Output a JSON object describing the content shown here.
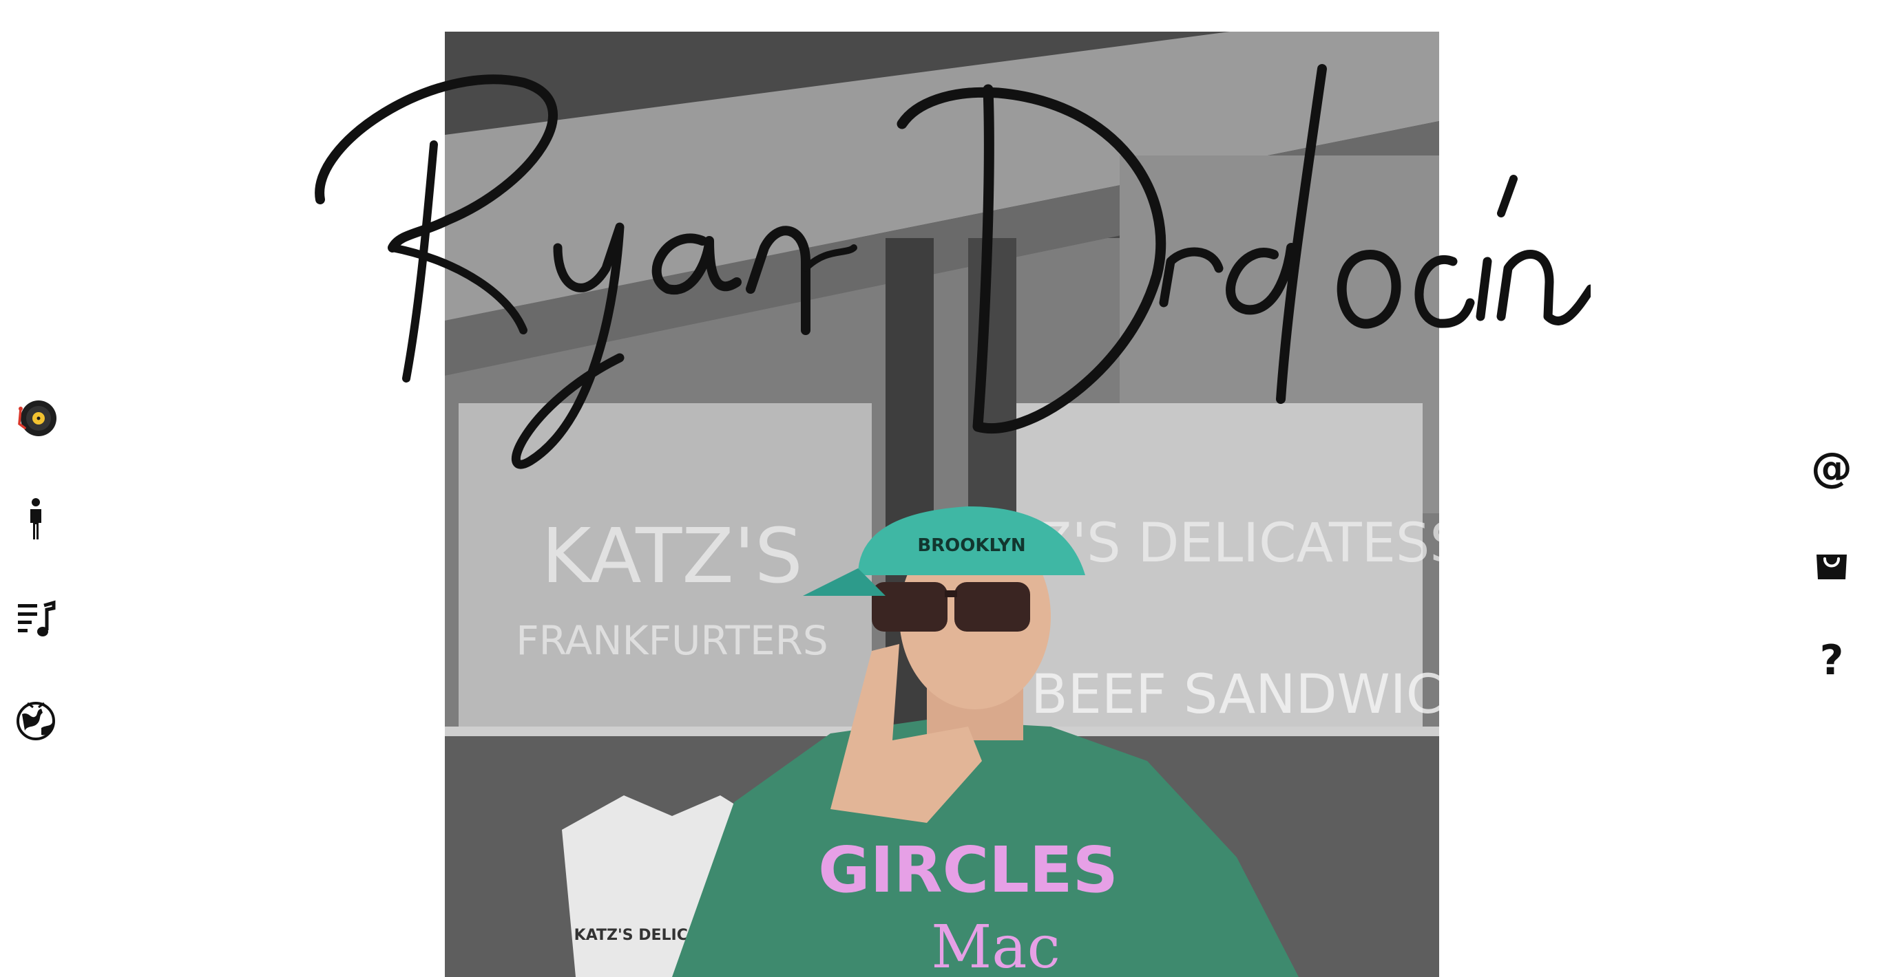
{
  "site": {
    "artist_name": "Ryan Drdocin"
  },
  "left_nav": [
    {
      "icon": "turntable-vinyl-icon",
      "label": "Music"
    },
    {
      "icon": "person-icon",
      "label": "About"
    },
    {
      "icon": "playlist-icon",
      "label": "Playlists"
    },
    {
      "icon": "globe-icon",
      "label": "World"
    }
  ],
  "right_nav": [
    {
      "icon": "at-sign-icon",
      "glyph": "@"
    },
    {
      "icon": "shopping-bag-icon",
      "glyph": ""
    },
    {
      "icon": "question-mark-icon",
      "glyph": "?"
    }
  ],
  "photo": {
    "shop_sign_left": "KATZ'S",
    "shop_sign_left_sub": "FRANKFURTERS",
    "shop_sign_right": "KATZ'S DELICATESSEN",
    "shop_sign_right_sub": "BEEF SANDWICH",
    "cap_text": "BROOKLYN",
    "shirt_text": "GIRCLES",
    "shirt_text_sub": "Mac",
    "tshirt_text": "KATZ'S DELICATESSEN"
  },
  "colors": {
    "ink": "#111111",
    "shirt_green": "#3e8a6e",
    "cap_teal": "#3fb7a4",
    "shirt_pink": "#e6a0e6",
    "vinyl_accent": "#f2c230",
    "vinyl_red": "#d9372a"
  }
}
